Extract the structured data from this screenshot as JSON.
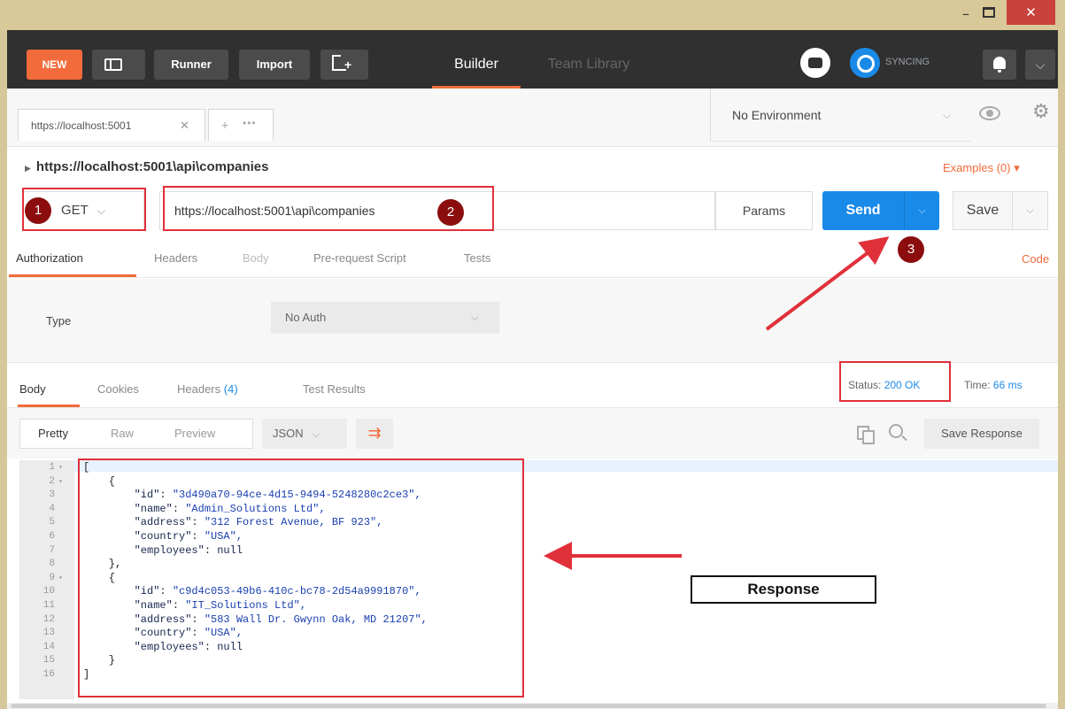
{
  "window": {
    "min_label": "–",
    "close_label": "✕"
  },
  "toolbar": {
    "new_label": "NEW",
    "runner_label": "Runner",
    "import_label": "Import",
    "builder_tab": "Builder",
    "team_library_tab": "Team Library",
    "sync_label": "SYNCING",
    "menu_label": "⌵"
  },
  "tabs": {
    "request_tab_label": "https://localhost:5001",
    "close_label": "✕",
    "new_tab_label": "+",
    "more_label": "•••",
    "environment": "No Environment",
    "gear_label": "⚙"
  },
  "request": {
    "title": "https://localhost:5001\\api\\companies",
    "caret": "▶",
    "examples": "Examples (0) ▾",
    "method": "GET",
    "url": "https://localhost:5001\\api\\companies",
    "params_label": "Params",
    "send_label": "Send",
    "save_label": "Save",
    "chevron": "⌵"
  },
  "request_tabs": {
    "authorization": "Authorization",
    "headers": "Headers",
    "body": "Body",
    "pre_request": "Pre-request Script",
    "tests": "Tests",
    "code": "Code"
  },
  "auth": {
    "type_label": "Type",
    "selected": "No Auth"
  },
  "response_tabs": {
    "body": "Body",
    "cookies": "Cookies",
    "headers": "Headers",
    "headers_count": "(4)",
    "test_results": "Test Results",
    "status_label": "Status:",
    "status_value": "200 OK",
    "time_label": "Time:",
    "time_value": "66 ms"
  },
  "response_toolbar": {
    "pretty": "Pretty",
    "raw": "Raw",
    "preview": "Preview",
    "format": "JSON",
    "wrap_glyph": "⇉",
    "save_response": "Save Response"
  },
  "code_lines": [
    {
      "n": "1",
      "fold": "▾",
      "text": "["
    },
    {
      "n": "2",
      "fold": "▾",
      "text": "    {"
    },
    {
      "n": "3",
      "fold": "",
      "key": "\"id\"",
      "val": "\"3d490a70-94ce-4d15-9494-5248280c2ce3\","
    },
    {
      "n": "4",
      "fold": "",
      "key": "\"name\"",
      "val": "\"Admin_Solutions Ltd\","
    },
    {
      "n": "5",
      "fold": "",
      "key": "\"address\"",
      "val": "\"312 Forest Avenue, BF 923\","
    },
    {
      "n": "6",
      "fold": "",
      "key": "\"country\"",
      "val": "\"USA\","
    },
    {
      "n": "7",
      "fold": "",
      "key": "\"employees\"",
      "val": "null"
    },
    {
      "n": "8",
      "fold": "",
      "text": "    },"
    },
    {
      "n": "9",
      "fold": "▾",
      "text": "    {"
    },
    {
      "n": "10",
      "fold": "",
      "key": "\"id\"",
      "val": "\"c9d4c053-49b6-410c-bc78-2d54a9991870\","
    },
    {
      "n": "11",
      "fold": "",
      "key": "\"name\"",
      "val": "\"IT_Solutions Ltd\","
    },
    {
      "n": "12",
      "fold": "",
      "key": "\"address\"",
      "val": "\"583 Wall Dr. Gwynn Oak, MD 21207\","
    },
    {
      "n": "13",
      "fold": "",
      "key": "\"country\"",
      "val": "\"USA\","
    },
    {
      "n": "14",
      "fold": "",
      "key": "\"employees\"",
      "val": "null"
    },
    {
      "n": "15",
      "fold": "",
      "text": "    }"
    },
    {
      "n": "16",
      "fold": "",
      "text": "]"
    }
  ],
  "annotations": {
    "badge_1": "1",
    "badge_2": "2",
    "badge_3": "3",
    "response_label": "Response"
  },
  "colors": {
    "accent": "#f26b3a",
    "send_blue": "#1a8ae8",
    "annotation_red": "#e0303a",
    "badge_dark_red": "#8b0d0d"
  }
}
